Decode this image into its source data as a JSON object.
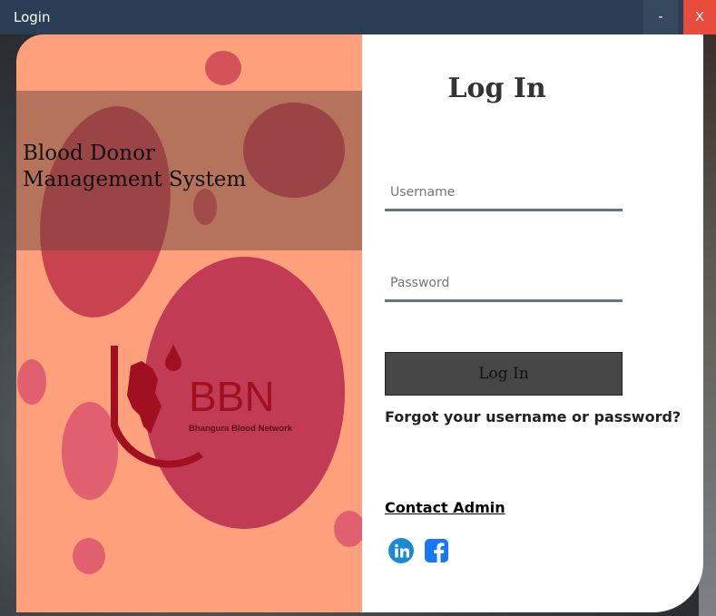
{
  "window": {
    "title": "Login",
    "minimize_label": "-",
    "close_label": "X"
  },
  "left": {
    "app_title_line1": "Blood Donor",
    "app_title_line2": "Management System",
    "logo_text": "BBN",
    "logo_subtext": "Bhangura Blood Network"
  },
  "form": {
    "heading": "Log In",
    "username_placeholder": "Username",
    "password_placeholder": "Password",
    "login_button": "Log In",
    "forgot_link": "Forgot your username or password?",
    "contact_link": "Contact Admin"
  },
  "social": [
    {
      "name": "linkedin-icon",
      "color": "#0e76a8"
    },
    {
      "name": "facebook-icon",
      "color": "#1877f2"
    }
  ],
  "colors": {
    "panel_bg": "#ffa07d",
    "blood_red": "#c0364d",
    "logo_red": "#a01020",
    "titlebar": "#2c3e55",
    "close": "#e74c3c"
  }
}
